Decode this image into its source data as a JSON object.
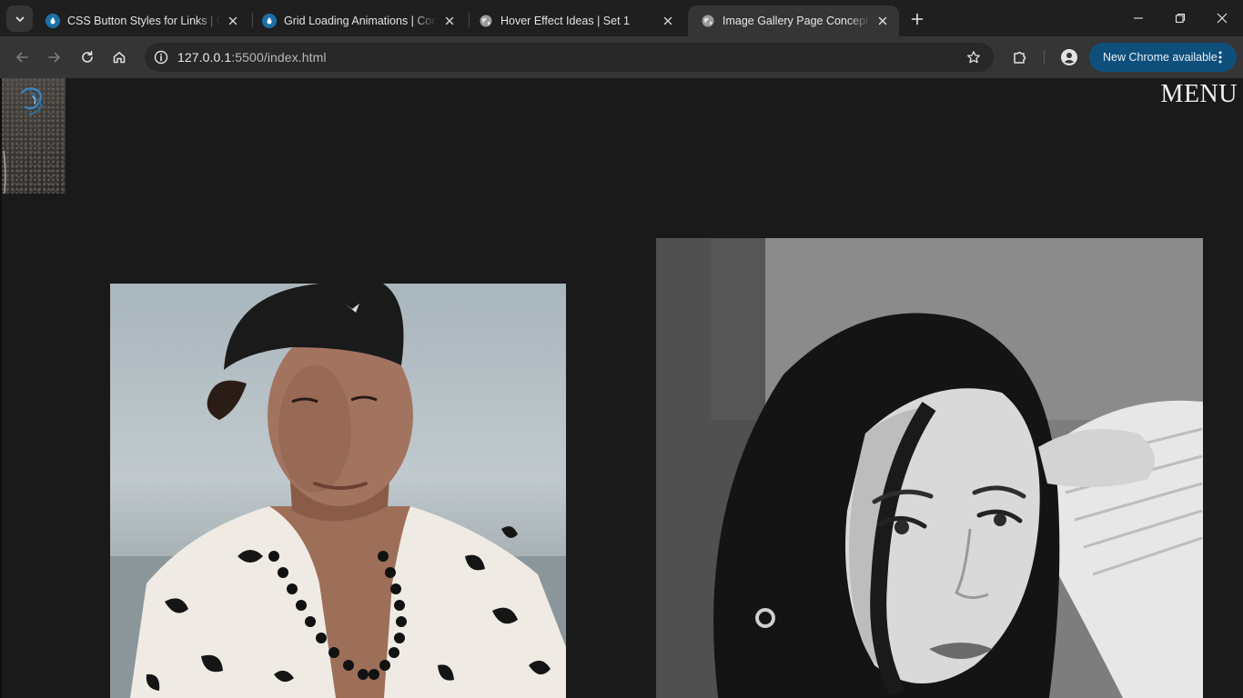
{
  "browser": {
    "tabs": [
      {
        "title": "CSS Button Styles for Links | Codrops",
        "favicon": "codrops-drop-icon",
        "active": false
      },
      {
        "title": "Grid Loading Animations | Codrops",
        "favicon": "codrops-drop-icon",
        "active": false
      },
      {
        "title": "Hover Effect Ideas | Set 1",
        "favicon": "globe-icon",
        "active": false
      },
      {
        "title": "Image Gallery Page Concept using CSS",
        "favicon": "globe-icon",
        "active": true
      }
    ],
    "address": {
      "host": "127.0.0.1",
      "rest": ":5500/index.html"
    },
    "update_button": "New Chrome available",
    "colors": {
      "tabstrip": "#1f1f1f",
      "toolbar": "#353535",
      "omnibox": "#282828",
      "update_pill": "#0e4f7c"
    }
  },
  "page": {
    "menu_label": "MENU",
    "background": "#1a1a1a",
    "images": [
      {
        "subject": "man in black cap and floral shirt with bead necklace",
        "palette": "color"
      },
      {
        "subject": "woman with dark hair, black and white portrait",
        "palette": "grayscale"
      }
    ]
  }
}
